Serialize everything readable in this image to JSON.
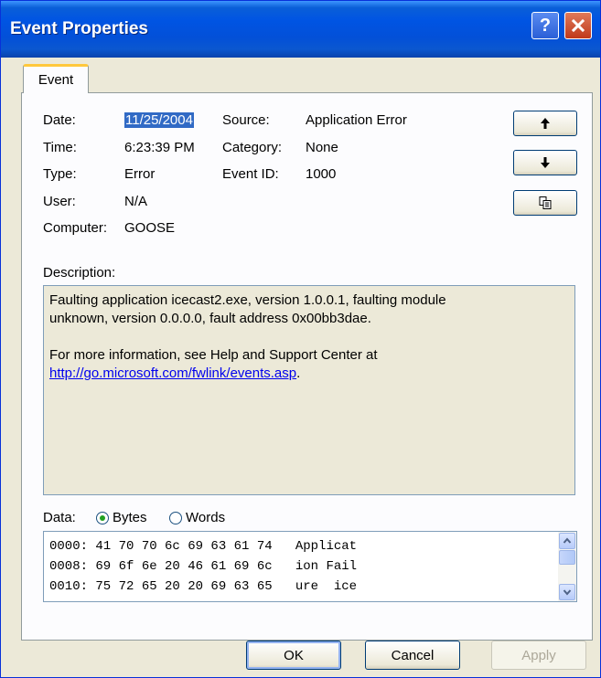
{
  "window": {
    "title": "Event Properties"
  },
  "titlebar": {
    "help_icon": "?"
  },
  "tabs": [
    {
      "label": "Event"
    }
  ],
  "fields": {
    "date_label": "Date:",
    "date_value": "11/25/2004",
    "time_label": "Time:",
    "time_value": "6:23:39 PM",
    "type_label": "Type:",
    "type_value": "Error",
    "user_label": "User:",
    "user_value": "N/A",
    "computer_label": "Computer:",
    "computer_value": "GOOSE",
    "source_label": "Source:",
    "source_value": "Application Error",
    "category_label": "Category:",
    "category_value": "None",
    "eventid_label": "Event ID:",
    "eventid_value": "1000"
  },
  "nav_icons": [
    "up-arrow-icon",
    "down-arrow-icon",
    "copy-icon"
  ],
  "description": {
    "label": "Description:",
    "line1": "Faulting application icecast2.exe, version 1.0.0.1, faulting module",
    "line2": "unknown, version 0.0.0.0, fault address 0x00bb3dae.",
    "line3": "For more information, see Help and Support Center at",
    "link": "http://go.microsoft.com/fwlink/events.asp",
    "link_suffix": "."
  },
  "data": {
    "label": "Data:",
    "options": [
      "Bytes",
      "Words"
    ],
    "selected": "Bytes",
    "lines": [
      "0000: 41 70 70 6c 69 63 61 74   Applicat",
      "0008: 69 6f 6e 20 46 61 69 6c   ion Fail",
      "0010: 75 72 65 20 20 69 63 65   ure  ice"
    ]
  },
  "buttons": {
    "ok": "OK",
    "cancel": "Cancel",
    "apply": "Apply"
  },
  "colors": {
    "titlebar": "#0054e3",
    "selection": "#316ac5",
    "window_bg": "#ece9d8",
    "link": "#0000ee"
  }
}
